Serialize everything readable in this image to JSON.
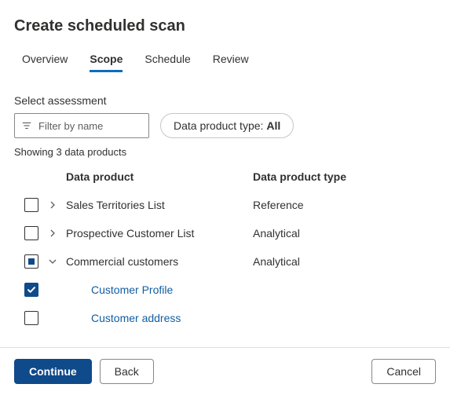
{
  "title": "Create scheduled scan",
  "tabs": [
    "Overview",
    "Scope",
    "Schedule",
    "Review"
  ],
  "activeTab": 1,
  "section_label": "Select assessment",
  "filter": {
    "placeholder": "Filter by name"
  },
  "pill": {
    "prefix": "Data product type: ",
    "value": "All"
  },
  "count_label": "Showing 3 data products",
  "columns": {
    "product": "Data product",
    "type": "Data product type"
  },
  "rows": [
    {
      "name": "Sales Territories List",
      "type": "Reference",
      "check": "unchecked",
      "expand": "collapsed",
      "indent": false,
      "link": false
    },
    {
      "name": "Prospective Customer List",
      "type": "Analytical",
      "check": "unchecked",
      "expand": "collapsed",
      "indent": false,
      "link": false
    },
    {
      "name": "Commercial customers",
      "type": "Analytical",
      "check": "partial",
      "expand": "expanded",
      "indent": false,
      "link": false
    },
    {
      "name": "Customer Profile",
      "type": "",
      "check": "checked",
      "expand": "none",
      "indent": true,
      "link": true
    },
    {
      "name": "Customer address",
      "type": "",
      "check": "unchecked",
      "expand": "none",
      "indent": true,
      "link": true
    }
  ],
  "buttons": {
    "continue": "Continue",
    "back": "Back",
    "cancel": "Cancel"
  }
}
